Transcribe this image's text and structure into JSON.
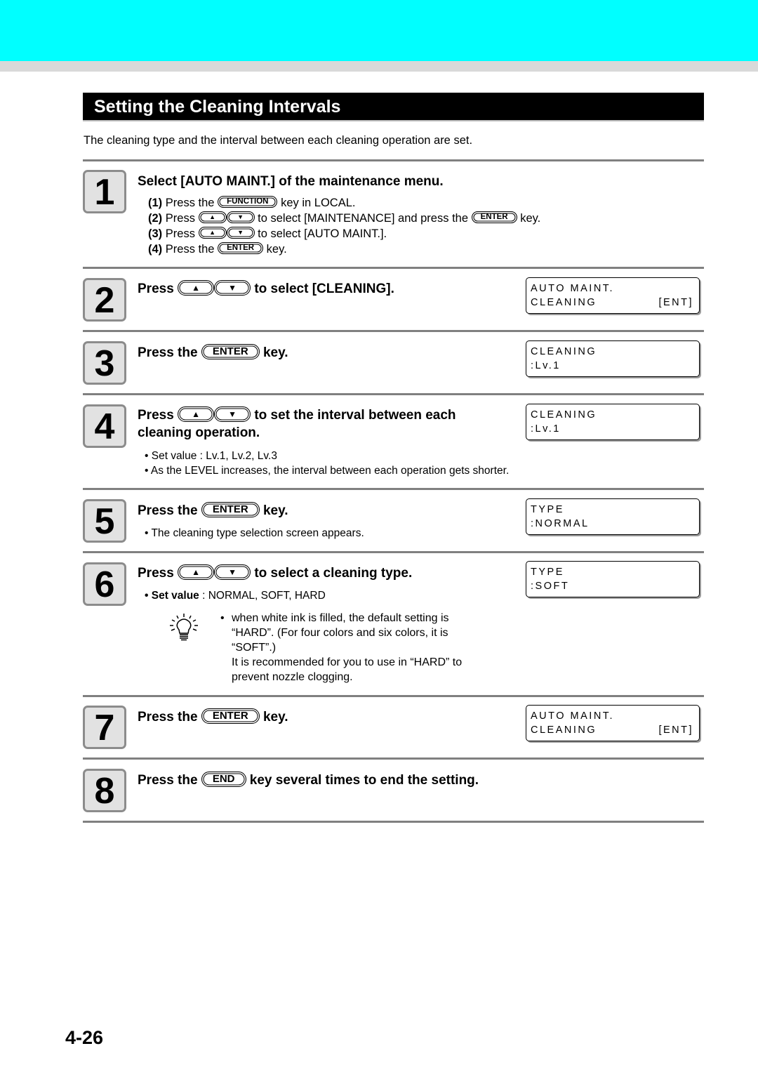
{
  "header": {
    "band_color": "#00ffff"
  },
  "section": {
    "title": "Setting the Cleaning Intervals",
    "intro": "The cleaning type and the interval between each cleaning operation are set."
  },
  "keys": {
    "function": "FUNCTION",
    "enter": "ENTER",
    "end": "END",
    "up": "▲",
    "down": "▼"
  },
  "steps": [
    {
      "number": "1",
      "heading": "Select [AUTO MAINT.] of the maintenance menu.",
      "substeps": [
        {
          "num": "(1)",
          "pre": "Press the",
          "post": "key in LOCAL."
        },
        {
          "num": "(2)",
          "pre": "Press",
          "mid": "to select [MAINTENANCE] and press the",
          "post": "key."
        },
        {
          "num": "(3)",
          "pre": "Press",
          "post": "to select [AUTO MAINT.]."
        },
        {
          "num": "(4)",
          "pre": "Press the",
          "post": "key."
        }
      ]
    },
    {
      "number": "2",
      "heading_pre": "Press",
      "heading_post": "to select [CLEANING].",
      "lcd": {
        "line1": "AUTO MAINT.",
        "line2": "CLEANING",
        "line2_right": "[ENT]"
      }
    },
    {
      "number": "3",
      "heading_pre": "Press the",
      "heading_post": "key.",
      "lcd": {
        "line1": "CLEANING",
        "line2": ":Lv.1"
      }
    },
    {
      "number": "4",
      "heading_pre": "Press",
      "heading_post": "to set the interval between each",
      "heading_line2": "cleaning operation.",
      "bullets": [
        "• Set value : Lv.1, Lv.2, Lv.3",
        "• As the LEVEL increases, the interval between each operation gets shorter."
      ],
      "lcd": {
        "line1": "CLEANING",
        "line2": ":Lv.1"
      }
    },
    {
      "number": "5",
      "heading_pre": "Press the",
      "heading_post": "key.",
      "bullets": [
        "• The cleaning type selection screen appears."
      ],
      "lcd": {
        "line1": "TYPE",
        "line2": ":NORMAL"
      }
    },
    {
      "number": "6",
      "heading_pre": "Press",
      "heading_post": "to select a cleaning type.",
      "set_value_label": "• Set value",
      "set_value_text": " : NORMAL, SOFT, HARD",
      "note": {
        "bullet": "•",
        "line1": "when white ink is filled, the default setting is “HARD”. (For four colors and six colors, it is “SOFT”.)",
        "line2": "It is recommended for you to use in “HARD” to prevent nozzle clogging."
      },
      "lcd": {
        "line1": "TYPE",
        "line2": ":SOFT"
      }
    },
    {
      "number": "7",
      "heading_pre": "Press the",
      "heading_post": "key.",
      "lcd": {
        "line1": "AUTO MAINT.",
        "line2": "CLEANING",
        "line2_right": "[ENT]"
      }
    },
    {
      "number": "8",
      "heading_pre": "Press the",
      "heading_post": "key several times to end the setting."
    }
  ],
  "footer": {
    "page_number": "4-26"
  }
}
